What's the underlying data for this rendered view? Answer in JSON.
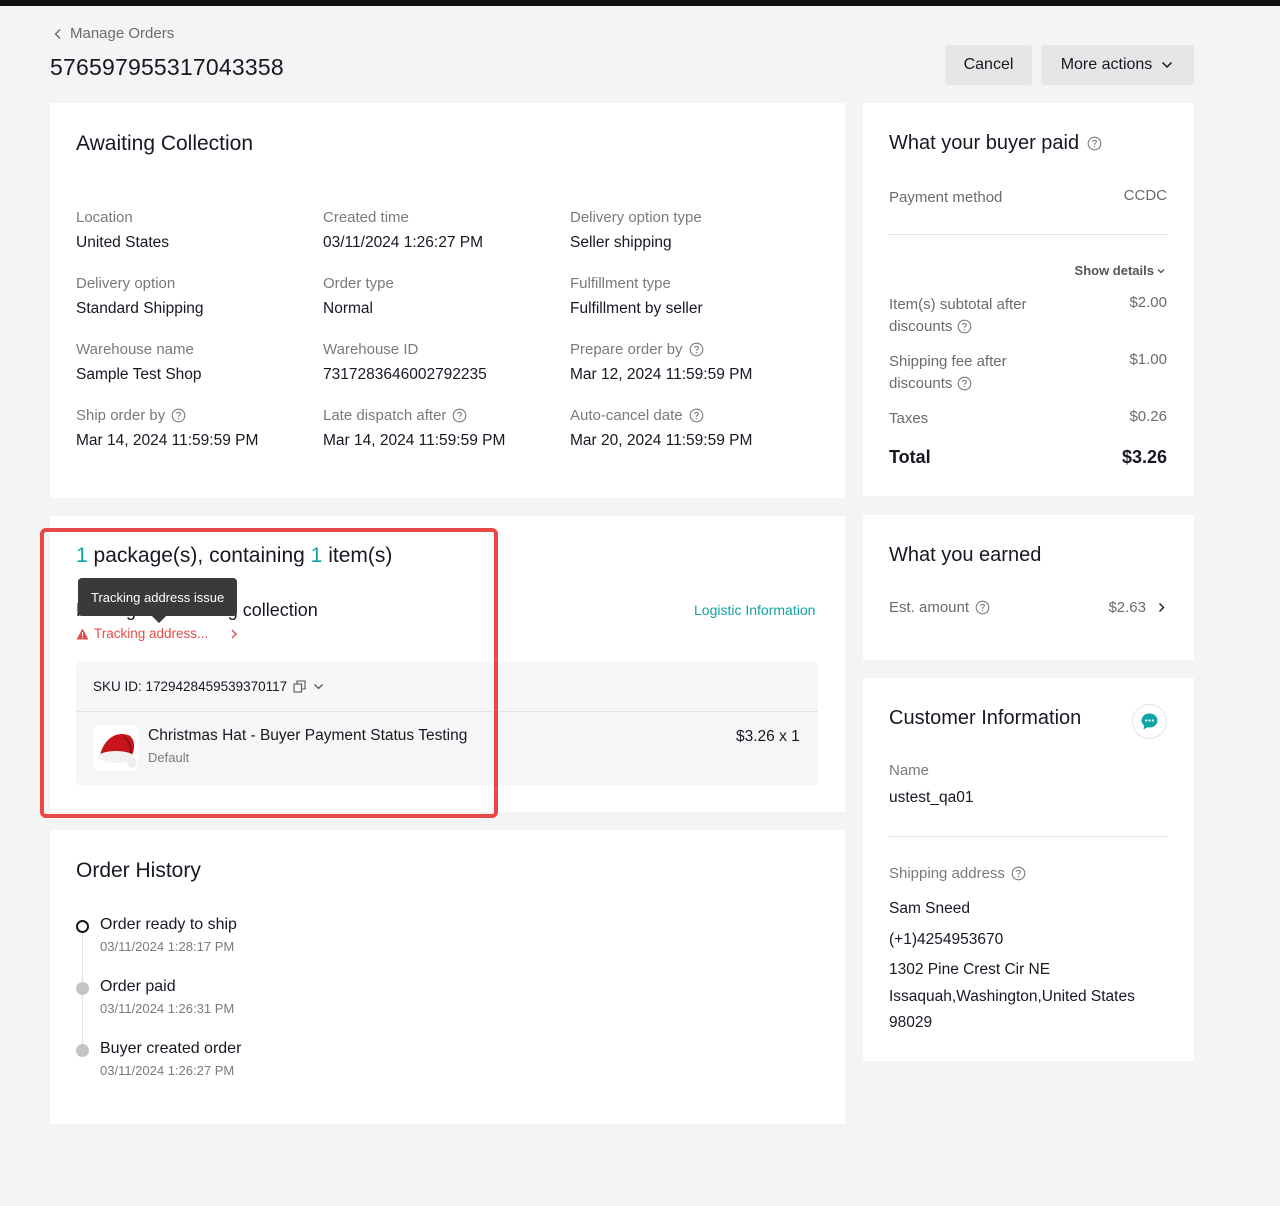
{
  "header": {
    "back_label": "Manage Orders",
    "order_id": "576597955317043358",
    "cancel_label": "Cancel",
    "more_actions_label": "More actions"
  },
  "status_card": {
    "title": "Awaiting Collection",
    "fields": [
      {
        "label": "Location",
        "value": "United States",
        "help": false
      },
      {
        "label": "Created time",
        "value": "03/11/2024 1:26:27 PM",
        "help": false
      },
      {
        "label": "Delivery option type",
        "value": "Seller shipping",
        "help": false
      },
      {
        "label": "Delivery option",
        "value": "Standard Shipping",
        "help": false
      },
      {
        "label": "Order type",
        "value": "Normal",
        "help": false
      },
      {
        "label": "Fulfillment type",
        "value": "Fulfillment by seller",
        "help": false
      },
      {
        "label": "Warehouse name",
        "value": "Sample Test Shop",
        "help": false
      },
      {
        "label": "Warehouse ID",
        "value": "7317283646002792235",
        "help": false
      },
      {
        "label": "Prepare order by",
        "value": "Mar 12, 2024 11:59:59 PM",
        "help": true
      },
      {
        "label": "Ship order by",
        "value": "Mar 14, 2024 11:59:59 PM",
        "help": true
      },
      {
        "label": "Late dispatch after",
        "value": "Mar 14, 2024 11:59:59 PM",
        "help": true
      },
      {
        "label": "Auto-cancel date",
        "value": "Mar 20, 2024 11:59:59 PM",
        "help": true
      }
    ]
  },
  "package": {
    "package_count": "1",
    "title_mid": "package(s), containing",
    "item_count": "1",
    "title_end": "item(s)",
    "subtitle": "Package 1: Awaiting collection",
    "tooltip": "Tracking address issue",
    "warning": "Tracking address...",
    "logistic_link": "Logistic Information",
    "sku": "SKU ID: 1729428459539370117",
    "item_name": "Christmas Hat - Buyer Payment Status Testing",
    "item_variant": "Default",
    "item_price": "$3.26 x 1"
  },
  "history": {
    "title": "Order History",
    "events": [
      {
        "title": "Order ready to ship",
        "time": "03/11/2024 1:28:17 PM",
        "state": "active"
      },
      {
        "title": "Order paid",
        "time": "03/11/2024 1:26:31 PM",
        "state": "done"
      },
      {
        "title": "Buyer created order",
        "time": "03/11/2024 1:26:27 PM",
        "state": "done"
      }
    ]
  },
  "buyer_paid": {
    "title": "What your buyer paid",
    "payment_method_label": "Payment method",
    "payment_method_value": "CCDC",
    "show_details": "Show details",
    "subtotal_label_1": "Item(s) subtotal after",
    "subtotal_label_2": "discounts",
    "subtotal_value": "$2.00",
    "shipping_label_1": "Shipping fee after",
    "shipping_label_2": "discounts",
    "shipping_value": "$1.00",
    "taxes_label": "Taxes",
    "taxes_value": "$0.26",
    "total_label": "Total",
    "total_value": "$3.26"
  },
  "earned": {
    "title": "What you earned",
    "est_label": "Est. amount",
    "est_value": "$2.63"
  },
  "customer": {
    "title": "Customer Information",
    "name_label": "Name",
    "name_value": "ustest_qa01",
    "address_label": "Shipping address",
    "recipient": "Sam Sneed",
    "phone": "(+1)4254953670",
    "street": "1302 Pine Crest Cir NE",
    "city_line": "Issaquah,Washington,United States",
    "zip": "98029"
  },
  "colors": {
    "accent": "#12a3a3",
    "warning": "#e34d4d",
    "highlight_box": "#e84848"
  }
}
